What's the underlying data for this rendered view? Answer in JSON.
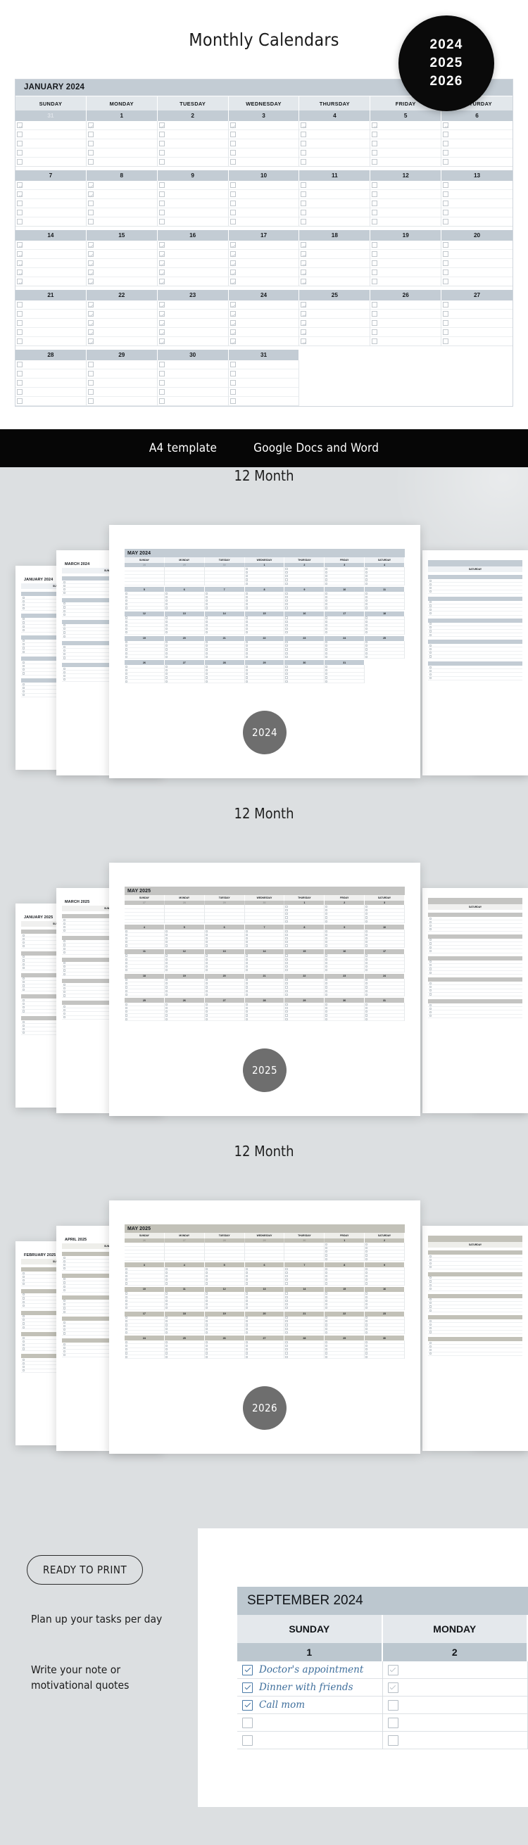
{
  "hero": {
    "title": "Monthly Calendars",
    "badge_years": [
      "2024",
      "2025",
      "2026"
    ]
  },
  "main_calendar": {
    "month_label": "JANUARY 2024",
    "day_headers": [
      "SUNDAY",
      "MONDAY",
      "TUESDAY",
      "WEDNESDAY",
      "THURSDAY",
      "FRIDAY",
      "SATURDAY"
    ],
    "lines_per_day": 5,
    "weeks": [
      {
        "days": [
          "31",
          "1",
          "2",
          "3",
          "4",
          "5",
          "6"
        ],
        "muted": [
          true,
          false,
          false,
          false,
          false,
          false,
          false
        ]
      },
      {
        "days": [
          "7",
          "8",
          "9",
          "10",
          "11",
          "12",
          "13"
        ],
        "muted": [
          false,
          false,
          false,
          false,
          false,
          false,
          false
        ]
      },
      {
        "days": [
          "14",
          "15",
          "16",
          "17",
          "18",
          "19",
          "20"
        ],
        "muted": [
          false,
          false,
          false,
          false,
          false,
          false,
          false
        ]
      },
      {
        "days": [
          "21",
          "22",
          "23",
          "24",
          "25",
          "26",
          "27"
        ],
        "muted": [
          false,
          false,
          false,
          false,
          false,
          false,
          false
        ]
      },
      {
        "days": [
          "28",
          "29",
          "30",
          "31",
          "",
          "",
          ""
        ],
        "muted": [
          false,
          false,
          false,
          false,
          false,
          false,
          false
        ]
      }
    ]
  },
  "banner": {
    "left_label": "A4 template",
    "right_label": "Google Docs and Word"
  },
  "showcases": [
    {
      "title": "12 Month",
      "badge": "2024",
      "front_month": "MAY 2024",
      "back_months": [
        "JANUARY 2024",
        "MARCH 2024"
      ],
      "day_headers": [
        "SUNDAY",
        "MONDAY",
        "TUESDAY",
        "WEDNESDAY",
        "THURSDAY",
        "FRIDAY",
        "SATURDAY"
      ],
      "header_color": "#c3ccd4",
      "dayrow_color": "#eef1f4",
      "weeks": [
        {
          "days": [
            "28",
            "29",
            "30",
            "1",
            "2",
            "3",
            "4"
          ],
          "muted": [
            true,
            true,
            true,
            false,
            false,
            false,
            false
          ]
        },
        {
          "days": [
            "5",
            "6",
            "7",
            "8",
            "9",
            "10",
            "11"
          ],
          "muted": [
            false,
            false,
            false,
            false,
            false,
            false,
            false
          ]
        },
        {
          "days": [
            "12",
            "13",
            "14",
            "15",
            "16",
            "17",
            "18"
          ],
          "muted": [
            false,
            false,
            false,
            false,
            false,
            false,
            false
          ]
        },
        {
          "days": [
            "19",
            "20",
            "21",
            "22",
            "23",
            "24",
            "25"
          ],
          "muted": [
            false,
            false,
            false,
            false,
            false,
            false,
            false
          ]
        },
        {
          "days": [
            "26",
            "27",
            "28",
            "29",
            "30",
            "31",
            ""
          ],
          "muted": [
            false,
            false,
            false,
            false,
            false,
            false,
            false
          ]
        }
      ]
    },
    {
      "title": "12 Month",
      "badge": "2025",
      "front_month": "MAY 2025",
      "back_months": [
        "JANUARY 2025",
        "MARCH 2025"
      ],
      "day_headers": [
        "SUNDAY",
        "MONDAY",
        "TUESDAY",
        "WEDNESDAY",
        "THURSDAY",
        "FRIDAY",
        "SATURDAY"
      ],
      "header_color": "#c4c4c2",
      "dayrow_color": "#f0f0ef",
      "weeks": [
        {
          "days": [
            "27",
            "28",
            "29",
            "30",
            "1",
            "2",
            "3"
          ],
          "muted": [
            true,
            true,
            true,
            true,
            false,
            false,
            false
          ]
        },
        {
          "days": [
            "4",
            "5",
            "6",
            "7",
            "8",
            "9",
            "10"
          ],
          "muted": [
            false,
            false,
            false,
            false,
            false,
            false,
            false
          ]
        },
        {
          "days": [
            "11",
            "12",
            "13",
            "14",
            "15",
            "16",
            "17"
          ],
          "muted": [
            false,
            false,
            false,
            false,
            false,
            false,
            false
          ]
        },
        {
          "days": [
            "18",
            "19",
            "20",
            "21",
            "22",
            "23",
            "24"
          ],
          "muted": [
            false,
            false,
            false,
            false,
            false,
            false,
            false
          ]
        },
        {
          "days": [
            "25",
            "26",
            "27",
            "28",
            "29",
            "30",
            "31"
          ],
          "muted": [
            false,
            false,
            false,
            false,
            false,
            false,
            false
          ]
        }
      ]
    },
    {
      "title": "12 Month",
      "badge": "2026",
      "front_month": "MAY 2025",
      "back_months": [
        "FEBRUARY 2025",
        "APRIL 2025"
      ],
      "day_headers": [
        "SUNDAY",
        "MONDAY",
        "TUESDAY",
        "WEDNESDAY",
        "THURSDAY",
        "FRIDAY",
        "SATURDAY"
      ],
      "header_color": "#c2c1b8",
      "dayrow_color": "#eeeeea",
      "weeks": [
        {
          "days": [
            "26",
            "27",
            "28",
            "29",
            "30",
            "1",
            "2"
          ],
          "muted": [
            true,
            true,
            true,
            true,
            true,
            false,
            false
          ]
        },
        {
          "days": [
            "3",
            "4",
            "5",
            "6",
            "7",
            "8",
            "9"
          ],
          "muted": [
            false,
            false,
            false,
            false,
            false,
            false,
            false
          ]
        },
        {
          "days": [
            "10",
            "11",
            "12",
            "13",
            "14",
            "15",
            "16"
          ],
          "muted": [
            false,
            false,
            false,
            false,
            false,
            false,
            false
          ]
        },
        {
          "days": [
            "17",
            "18",
            "19",
            "20",
            "21",
            "22",
            "23"
          ],
          "muted": [
            false,
            false,
            false,
            false,
            false,
            false,
            false
          ]
        },
        {
          "days": [
            "24",
            "25",
            "26",
            "27",
            "28",
            "29",
            "30"
          ],
          "muted": [
            false,
            false,
            false,
            false,
            false,
            false,
            false
          ]
        }
      ]
    }
  ],
  "bottom": {
    "pill_label": "READY TO PRINT",
    "blurb_1": "Plan up your tasks per day",
    "blurb_2": "Write your note or motivational quotes",
    "sample": {
      "month_label": "SEPTEMBER 2024",
      "day_headers": [
        "SUNDAY",
        "MONDAY"
      ],
      "day_numbers": [
        "1",
        "2"
      ],
      "sunday_tasks": [
        {
          "text": "Doctor's appointment",
          "checked": true
        },
        {
          "text": "Dinner with friends",
          "checked": true
        },
        {
          "text": "Call mom",
          "checked": true
        },
        {
          "text": "",
          "checked": false
        },
        {
          "text": "",
          "checked": false
        }
      ],
      "monday_tasks": [
        {
          "text": "",
          "checked": "grey"
        },
        {
          "text": "",
          "checked": "grey"
        },
        {
          "text": "",
          "checked": false
        },
        {
          "text": "",
          "checked": false
        },
        {
          "text": "",
          "checked": false
        }
      ]
    }
  },
  "colors": {
    "banner_bg": "#060606",
    "badge_bg": "#0a0a0a",
    "showcase_bg": "#dcdfe1",
    "accent_blue_grey": "#c3ccd4",
    "hand_blue": "#3f6f9c",
    "circle_badge": "#6e6e6e"
  }
}
